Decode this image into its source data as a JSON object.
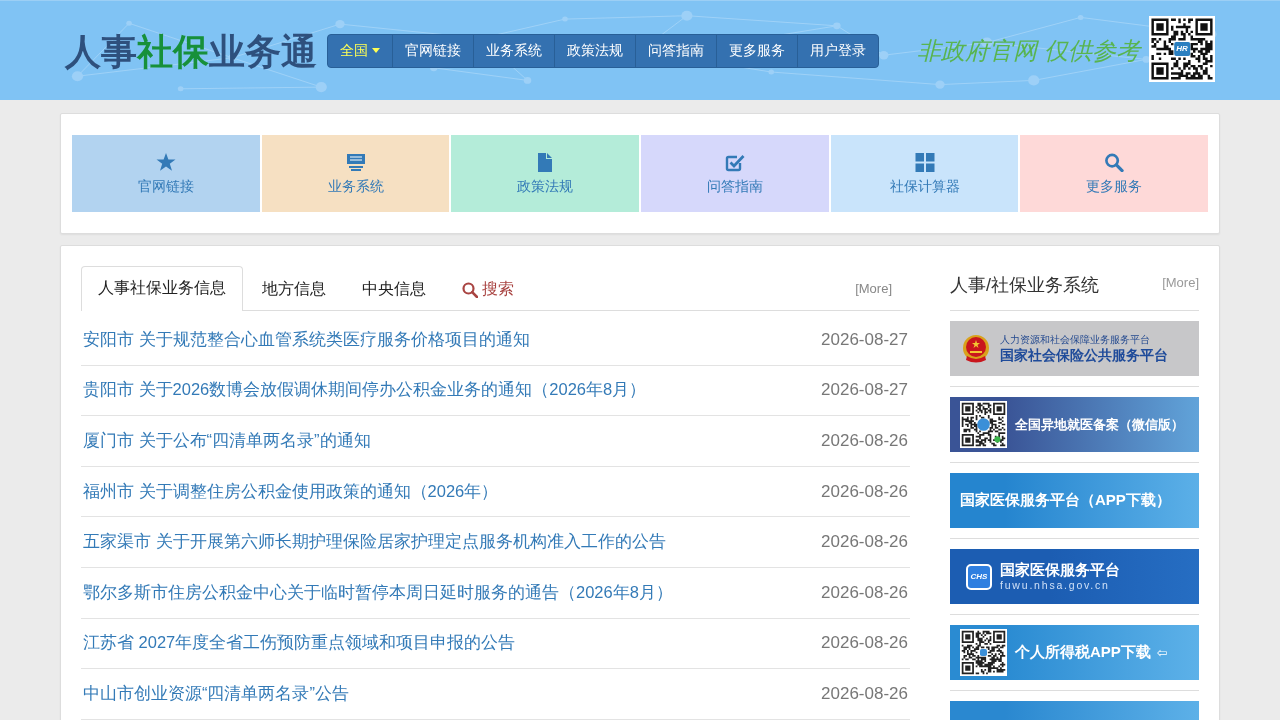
{
  "header": {
    "logo": [
      {
        "text": "人事",
        "kind": "plain"
      },
      {
        "text": "社保",
        "kind": "accent"
      },
      {
        "text": "业务通",
        "kind": "plain"
      }
    ],
    "nav": [
      {
        "label": "全国",
        "kind": "dropdown"
      },
      {
        "label": "官网链接",
        "kind": "link"
      },
      {
        "label": "业务系统",
        "kind": "link"
      },
      {
        "label": "政策法规",
        "kind": "link"
      },
      {
        "label": "问答指南",
        "kind": "link"
      },
      {
        "label": "更多服务",
        "kind": "link"
      },
      {
        "label": "用户登录",
        "kind": "link"
      }
    ],
    "slogan": "非政府官网 仅供参考",
    "qr_badge": "HR"
  },
  "shortcuts": [
    {
      "label": "官网链接",
      "color": "#b2d3f0"
    },
    {
      "label": "业务系统",
      "color": "#f6e0c2"
    },
    {
      "label": "政策法规",
      "color": "#b4ecd9"
    },
    {
      "label": "问答指南",
      "color": "#d6d8fb"
    },
    {
      "label": "社保计算器",
      "color": "#c9e4fb"
    },
    {
      "label": "更多服务",
      "color": "#fed9d8"
    }
  ],
  "news": {
    "tabs": [
      {
        "label": "人事社保业务信息",
        "kind": "text",
        "selected": true
      },
      {
        "label": "地方信息",
        "kind": "text",
        "selected": false
      },
      {
        "label": "中央信息",
        "kind": "text",
        "selected": false
      },
      {
        "label": "搜索",
        "kind": "search",
        "selected": false
      }
    ],
    "more": "[More]",
    "items": [
      {
        "title": "安阳市 关于规范整合心血管系统类医疗服务价格项目的通知",
        "date": "2026-08-27"
      },
      {
        "title": "贵阳市 关于2026数博会放假调休期间停办公积金业务的通知（2026年8月）",
        "date": "2026-08-27"
      },
      {
        "title": "厦门市 关于公布“四清单两名录”的通知",
        "date": "2026-08-26"
      },
      {
        "title": "福州市 关于调整住房公积金使用政策的通知（2026年）",
        "date": "2026-08-26"
      },
      {
        "title": "五家渠市 关于开展第六师长期护理保险居家护理定点服务机构准入工作的公告",
        "date": "2026-08-26"
      },
      {
        "title": "鄂尔多斯市住房公积金中心关于临时暂停本周日延时服务的通告（2026年8月）",
        "date": "2026-08-26"
      },
      {
        "title": "江苏省 2027年度全省工伤预防重点领域和项目申报的公告",
        "date": "2026-08-26"
      },
      {
        "title": "中山市创业资源“四清单两名录”公告",
        "date": "2026-08-26"
      }
    ]
  },
  "sidebar": {
    "title": "人事/社保业务系统",
    "more": "[More]",
    "banners": [
      {
        "kind": "emblem",
        "color": "#c7c7c9",
        "subtitle": "人力资源和社会保障业务服务平台",
        "title": "国家社会保险公共服务平台"
      },
      {
        "kind": "qr",
        "color": "#3a5496",
        "title": "全国异地就医备案（微信版）"
      },
      {
        "kind": "plain",
        "color": "#2585cf",
        "title": "国家医保服务平台（APP下载）"
      },
      {
        "kind": "logo",
        "color": "#1c5db2",
        "badge": "CHS",
        "title": "国家医保服务平台",
        "subtitle": "fuwu.nhsa.gov.cn"
      },
      {
        "kind": "qr",
        "color": "#2a8bd2",
        "title": "个人所得税APP下载",
        "arrow": "⇦"
      },
      {
        "kind": "blank",
        "color": "#2a88d0"
      }
    ]
  }
}
